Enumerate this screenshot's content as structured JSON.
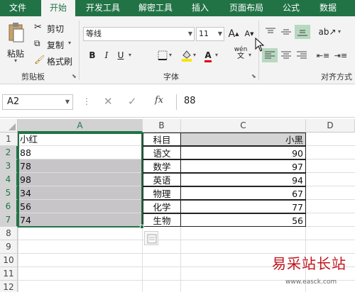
{
  "tabs": [
    "文件",
    "开始",
    "开发工具",
    "解密工具",
    "插入",
    "页面布局",
    "公式",
    "数据"
  ],
  "active_tab": "开始",
  "clipboard": {
    "paste": "粘贴",
    "cut": "剪切",
    "copy": "复制",
    "format_painter": "格式刷",
    "group_label": "剪贴板"
  },
  "font": {
    "name": "等线",
    "size": "11",
    "group_label": "字体",
    "bold": "B",
    "italic": "I",
    "underline": "U",
    "grow": "A",
    "shrink": "A",
    "wen": "wén"
  },
  "alignment": {
    "group_label": "对齐方式"
  },
  "formula_bar": {
    "name_box": "A2",
    "fx": "fx",
    "value": "88"
  },
  "sheet": {
    "columns": [
      "A",
      "B",
      "C",
      "D"
    ],
    "rows": [
      "1",
      "2",
      "3",
      "4",
      "5",
      "6",
      "7",
      "8",
      "9",
      "10",
      "11",
      "12"
    ],
    "data": [
      [
        "小红",
        "科目",
        "小黑"
      ],
      [
        "88",
        "语文",
        "90"
      ],
      [
        "78",
        "数学",
        "97"
      ],
      [
        "98",
        "英语",
        "94"
      ],
      [
        "34",
        "物理",
        "67"
      ],
      [
        "56",
        "化学",
        "77"
      ],
      [
        "74",
        "生物",
        "56"
      ]
    ]
  },
  "watermark": {
    "text": "易采站长站",
    "url": "www.easck.com"
  },
  "colors": {
    "excel_green": "#217346",
    "selection_fill": "#c8c5c9"
  }
}
